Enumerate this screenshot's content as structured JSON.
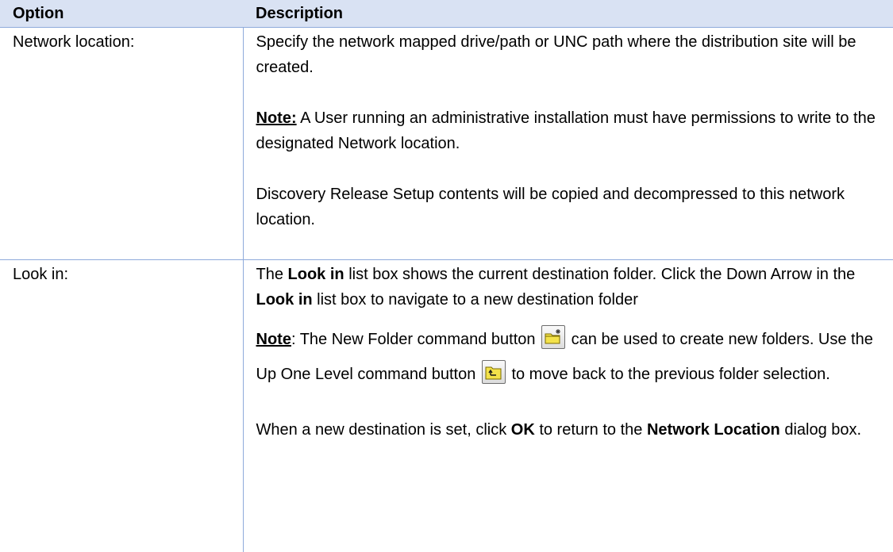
{
  "table": {
    "headers": {
      "option": "Option",
      "description": "Description"
    },
    "row1": {
      "option": "Network location:",
      "desc_para1": "Specify the network mapped drive/path or UNC path where the distribution site will be created.",
      "note_label": "Note:",
      "note_text": " A User running an administrative installation must have permissions to write to the designated Network location.",
      "desc_para3": "Discovery Release Setup contents will be copied and decompressed to this network location."
    },
    "row2": {
      "option": "Look in:",
      "p1_a": "The ",
      "p1_b1": "Look in",
      "p1_c": " list box shows the current destination folder. Click the Down Arrow in the ",
      "p1_b2": "Look in",
      "p1_d": " list box to navigate to a new destination folder",
      "note_label": "Note",
      "note_a": ": The New Folder command button ",
      "note_b": " can be used to create new folders. Use the Up One Level command button ",
      "note_c": " to move back to the previous folder selection.",
      "p3_a": "When a new destination is set, click ",
      "p3_ok": "OK",
      "p3_b": " to return to the ",
      "p3_nl": "Network Location",
      "p3_c": " dialog box."
    }
  },
  "icons": {
    "new_folder": "new-folder-icon",
    "up_one_level": "up-one-level-icon"
  },
  "colors": {
    "header_bg": "#d9e2f3",
    "border": "#8eaadb"
  }
}
